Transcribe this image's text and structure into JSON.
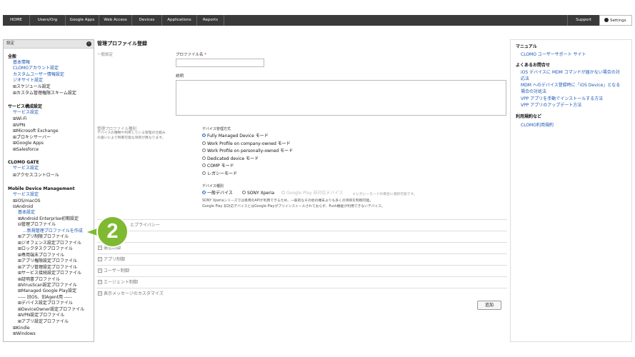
{
  "nav": {
    "items": [
      "HOME",
      "Users/Org",
      "Google Apps",
      "Web Access",
      "Devices",
      "Applications",
      "Reports"
    ],
    "support": "Support",
    "settings": "Settings"
  },
  "sidebar": {
    "header": "設定",
    "collapse_icon": "‹",
    "lines": [
      {
        "text": "全般",
        "style": "h",
        "indent": 0
      },
      {
        "text": "基本情報",
        "style": "link",
        "indent": 1
      },
      {
        "text": "CLOMOアカウント設定",
        "style": "link",
        "indent": 1
      },
      {
        "text": "カスタムユーザー情報設定",
        "style": "link",
        "indent": 1
      },
      {
        "text": "ジオサイト設定",
        "style": "link",
        "indent": 1
      },
      {
        "text": "⊞スケジュール設定",
        "style": "plain",
        "indent": 1
      },
      {
        "text": "⊞カスタム管理権限スキーム設定",
        "style": "plain",
        "indent": 1
      },
      {
        "text": "",
        "style": "plain",
        "indent": 0
      },
      {
        "text": "サービス構成設定",
        "style": "h",
        "indent": 0
      },
      {
        "text": "サービス設定",
        "style": "link",
        "indent": 1
      },
      {
        "text": "⊞Wi-Fi",
        "style": "plain",
        "indent": 1
      },
      {
        "text": "⊞VPN",
        "style": "plain",
        "indent": 1
      },
      {
        "text": "⊞Microsoft Exchange",
        "style": "plain",
        "indent": 1
      },
      {
        "text": "⊞プロキシサーバー",
        "style": "plain",
        "indent": 1
      },
      {
        "text": "⊞Google Apps",
        "style": "plain",
        "indent": 1
      },
      {
        "text": "⊞Salesforce",
        "style": "plain",
        "indent": 1
      },
      {
        "text": "",
        "style": "plain",
        "indent": 0
      },
      {
        "text": "CLOMO GATE",
        "style": "h",
        "indent": 0
      },
      {
        "text": "サービス設定",
        "style": "link",
        "indent": 1
      },
      {
        "text": "⊞アクセスコントロール",
        "style": "plain",
        "indent": 1
      },
      {
        "text": "",
        "style": "plain",
        "indent": 0
      },
      {
        "text": "Mobile Device Management",
        "style": "h",
        "indent": 0
      },
      {
        "text": "サービス設定",
        "style": "link",
        "indent": 1
      },
      {
        "text": "⊞iOS/macOS",
        "style": "plain",
        "indent": 1
      },
      {
        "text": "⊟Android",
        "style": "plain",
        "indent": 1
      },
      {
        "text": "基本設定",
        "style": "link",
        "indent": 2
      },
      {
        "text": "⊞Android Enterprise初期設定",
        "style": "plain",
        "indent": 2
      },
      {
        "text": "⊟管理プロファイル",
        "style": "plain",
        "indent": 2
      },
      {
        "text": "...新規管理プロファイルを作成",
        "style": "sel",
        "indent": 3
      },
      {
        "text": "⊞アプリ制限プロファイル",
        "style": "plain",
        "indent": 2
      },
      {
        "text": "⊞ジオフェンス設定プロファイル",
        "style": "plain",
        "indent": 2
      },
      {
        "text": "⊞ロックタスクプロファイル",
        "style": "plain",
        "indent": 2
      },
      {
        "text": "⊞専用端末プロファイル",
        "style": "plain",
        "indent": 2
      },
      {
        "text": "⊞アプリ権限設定プロファイル",
        "style": "plain",
        "indent": 2
      },
      {
        "text": "⊞アプリ管理設定プロファイル",
        "style": "plain",
        "indent": 2
      },
      {
        "text": "⊞サービス接続設定プロファイル",
        "style": "plain",
        "indent": 2
      },
      {
        "text": "⊞証明書プロファイル",
        "style": "plain",
        "indent": 2
      },
      {
        "text": "⊞VirusScan設定プロファイル",
        "style": "plain",
        "indent": 2
      },
      {
        "text": "⊞Managed Google Play設定",
        "style": "plain",
        "indent": 2
      },
      {
        "text": "----- 旧OS、旧Agent用 -----",
        "style": "plain",
        "indent": 2
      },
      {
        "text": "⊞デバイス設定プロファイル",
        "style": "plain",
        "indent": 2
      },
      {
        "text": "⊞DeviceOwner設定プロファイル",
        "style": "plain",
        "indent": 2
      },
      {
        "text": "⊞VPN設定プロファイル",
        "style": "plain",
        "indent": 2
      },
      {
        "text": "⊞アプリ設定プロファイル",
        "style": "plain",
        "indent": 2
      },
      {
        "text": "⊞Kindle",
        "style": "plain",
        "indent": 1
      },
      {
        "text": "⊞Windows",
        "style": "plain",
        "indent": 1
      }
    ]
  },
  "main": {
    "title": "管理プロファイル登録",
    "general_label": "一般設定",
    "profile_name_label": "プロファイル名",
    "required_mark": "*",
    "profile_name_value": "",
    "description_label": "説明",
    "description_value": "",
    "profile_type_label": "管理プロファイル種別",
    "profile_type_desc": "デバイスの種類や利用している管理の仕組みの違いにより制御可能な項目が異なります。",
    "device_mode_label": "デバイス管理方式",
    "device_modes": [
      {
        "label": "Fully Managed Device モード",
        "selected": true
      },
      {
        "label": "Work Profile on company-owned モード",
        "selected": false
      },
      {
        "label": "Work Profile on personally-owned モード",
        "selected": false
      },
      {
        "label": "Dedicated device モード",
        "selected": false
      },
      {
        "label": "COMP モード",
        "selected": false
      },
      {
        "label": "レガシーモード",
        "selected": false
      }
    ],
    "device_type_label": "デバイス種別",
    "device_types": [
      {
        "label": "一般デバイス",
        "selected": true,
        "disabled": false
      },
      {
        "label": "SONY Xperia",
        "selected": false,
        "disabled": false
      },
      {
        "label": "Google Play 非対応デバイス",
        "selected": false,
        "disabled": true
      }
    ],
    "device_type_hint": "＊レガシーモードの場合に選択可能です。",
    "notes": [
      "SONY Xperiaシリーズでは専用のAPIが利用できるため、一般的なその他の端末よりも多くの項目を制御可能。",
      "Google Play 非対応デバイスとはGoogle Playがプリインストールされておらず、Push機能が利用できないデバイス。"
    ],
    "sections": [
      "セキュリティとプライバシー",
      "",
      "通信制御",
      "アプリ制御",
      "ユーザー制御",
      "エージェント制御",
      "表示メッセージのカスタマイズ"
    ],
    "section_visible_fragment": "とプライバシー",
    "add_button": "追加"
  },
  "right": {
    "items": [
      {
        "text": "マニュアル",
        "style": "h"
      },
      {
        "text": "CLOMO ユーザーサポート サイト",
        "style": "link"
      },
      {
        "text": "",
        "style": "plain"
      },
      {
        "text": "よくあるお問合せ",
        "style": "h"
      },
      {
        "text": "iOS デバイスに MDM コマンドが届かない場合の対",
        "style": "link"
      },
      {
        "text": "応法",
        "style": "link"
      },
      {
        "text": "MDM へのデバイス登録時に「iOS Device」となる",
        "style": "link"
      },
      {
        "text": "場合の対処法",
        "style": "link"
      },
      {
        "text": "VPP アプリを手動でインストールする方法",
        "style": "link"
      },
      {
        "text": "VPP アプリのアップデート方法",
        "style": "link"
      },
      {
        "text": "",
        "style": "plain"
      },
      {
        "text": "利用規約など",
        "style": "h"
      },
      {
        "text": "CLOMO利用規約",
        "style": "link"
      }
    ]
  },
  "callout": {
    "number": "2",
    "color": "#7fb931"
  }
}
